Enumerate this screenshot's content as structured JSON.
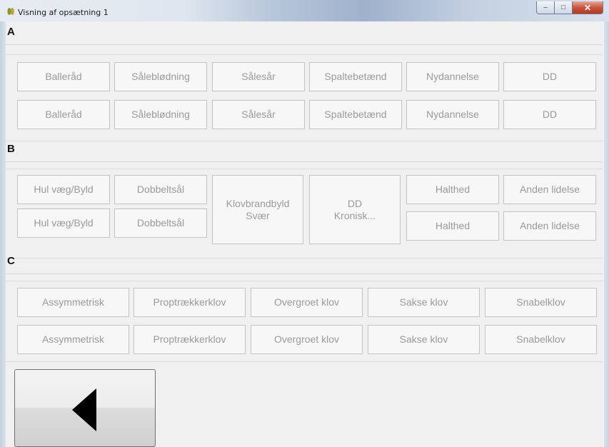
{
  "window": {
    "title": "Visning af opsætning 1",
    "controls": {
      "minimize": "–",
      "maximize": "□",
      "close": "✕"
    }
  },
  "sectionA": {
    "label": "A",
    "row1": [
      "Balleråd",
      "Sålebl&oslash;dning",
      "Sålesår",
      "Spaltebetænd",
      "Nydannelse",
      "DD"
    ],
    "row2": [
      "Balleråd",
      "Sålebl&oslash;dning",
      "Sålesår",
      "Spaltebetænd",
      "Nydannelse",
      "DD"
    ]
  },
  "sectionB": {
    "label": "B",
    "row1": [
      "Hul væg/Byld",
      "Dobbeltsål",
      "Halthed",
      "Anden lidelse"
    ],
    "row2": [
      "Hul væg/Byld",
      "Dobbeltsål",
      "Halthed",
      "Anden lidelse"
    ],
    "klov": {
      "line1": "Klovbrandbyld",
      "line2": "Svær"
    },
    "dd": {
      "line1": "DD",
      "line2": "Kronisk..."
    }
  },
  "sectionC": {
    "label": "C",
    "row1": [
      "Assymmetrisk",
      "Proptrækkerklov",
      "Overgroet klov",
      "Sakse klov",
      "Snabelklov"
    ],
    "row2": [
      "Assymmetrisk",
      "Proptrækkerklov",
      "Overgroet klov",
      "Sakse klov",
      "Snabelklov"
    ]
  },
  "back_button": {
    "icon": "left-triangle-icon"
  }
}
